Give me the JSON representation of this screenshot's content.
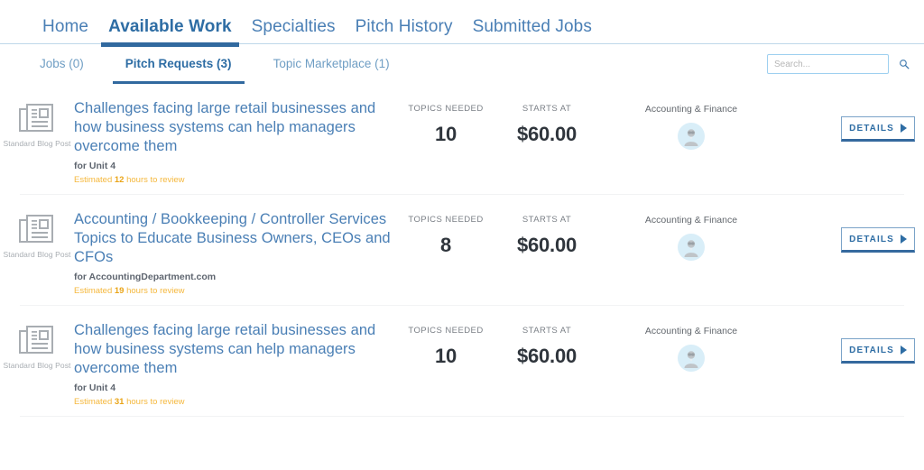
{
  "topnav": {
    "items": [
      {
        "label": "Home",
        "active": false
      },
      {
        "label": "Available Work",
        "active": true
      },
      {
        "label": "Specialties",
        "active": false
      },
      {
        "label": "Pitch History",
        "active": false
      },
      {
        "label": "Submitted Jobs",
        "active": false
      }
    ]
  },
  "subtabs": {
    "items": [
      {
        "label": "Jobs (0)",
        "active": false
      },
      {
        "label": "Pitch Requests (3)",
        "active": true
      },
      {
        "label": "Topic Marketplace (1)",
        "active": false
      }
    ]
  },
  "search": {
    "value": "",
    "placeholder": "Search...",
    "icon": "search-icon"
  },
  "columns": {
    "topics_needed": "TOPICS NEEDED",
    "starts_at": "STARTS AT"
  },
  "rows": [
    {
      "icon": "newspaper-icon",
      "type_label": "Standard Blog Post",
      "title": "Challenges facing large retail businesses and how business systems can help managers overcome them",
      "for_label": "for Unit 4",
      "estimate_prefix": "Estimated",
      "estimate_hours": "12",
      "estimate_suffix": "hours to review",
      "topics_needed": "10",
      "starts_at": "$60.00",
      "category": "Accounting & Finance",
      "avatar": "user-avatar",
      "details_label": "DETAILS"
    },
    {
      "icon": "newspaper-icon",
      "type_label": "Standard Blog Post",
      "title": "Accounting / Bookkeeping / Controller Services Topics to Educate Business Owners, CEOs and CFOs",
      "for_label": "for AccountingDepartment.com",
      "estimate_prefix": "Estimated",
      "estimate_hours": "19",
      "estimate_suffix": "hours to review",
      "topics_needed": "8",
      "starts_at": "$60.00",
      "category": "Accounting & Finance",
      "avatar": "user-avatar",
      "details_label": "DETAILS"
    },
    {
      "icon": "newspaper-icon",
      "type_label": "Standard Blog Post",
      "title": "Challenges facing large retail businesses and how business systems can help managers overcome them",
      "for_label": "for Unit 4",
      "estimate_prefix": "Estimated",
      "estimate_hours": "31",
      "estimate_suffix": "hours to review",
      "topics_needed": "10",
      "starts_at": "$60.00",
      "category": "Accounting & Finance",
      "avatar": "user-avatar",
      "details_label": "DETAILS"
    }
  ],
  "colors": {
    "link_blue": "#4a7fb5",
    "active_blue": "#2e6da4",
    "amber": "#f5b83d",
    "value_dark": "#2f353c",
    "avatar_bg": "#d9eef8"
  }
}
